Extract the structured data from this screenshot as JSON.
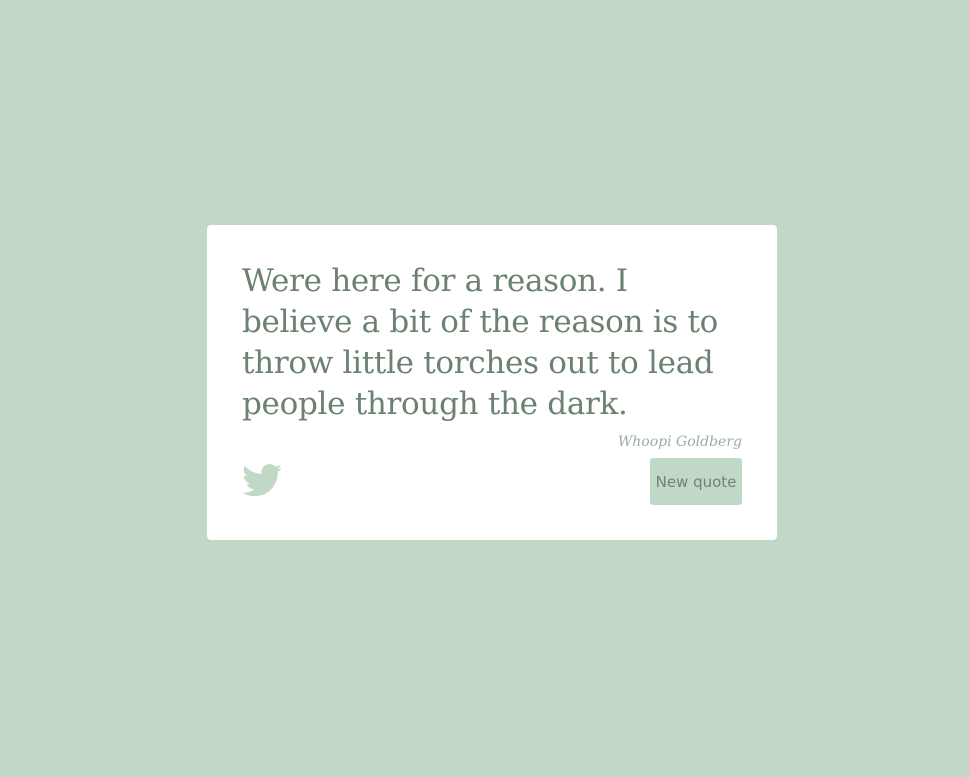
{
  "quote": {
    "text": "Were here for a reason. I believe a bit of the reason is to throw little torches out to lead people through the dark.",
    "author": "Whoopi Goldberg"
  },
  "actions": {
    "tweet_icon": "twitter-bird-icon",
    "new_quote_label": "New quote"
  },
  "colors": {
    "background": "#c2d8c7",
    "card": "#ffffff",
    "text": "#6b8270",
    "accent": "#c2d8c7"
  }
}
